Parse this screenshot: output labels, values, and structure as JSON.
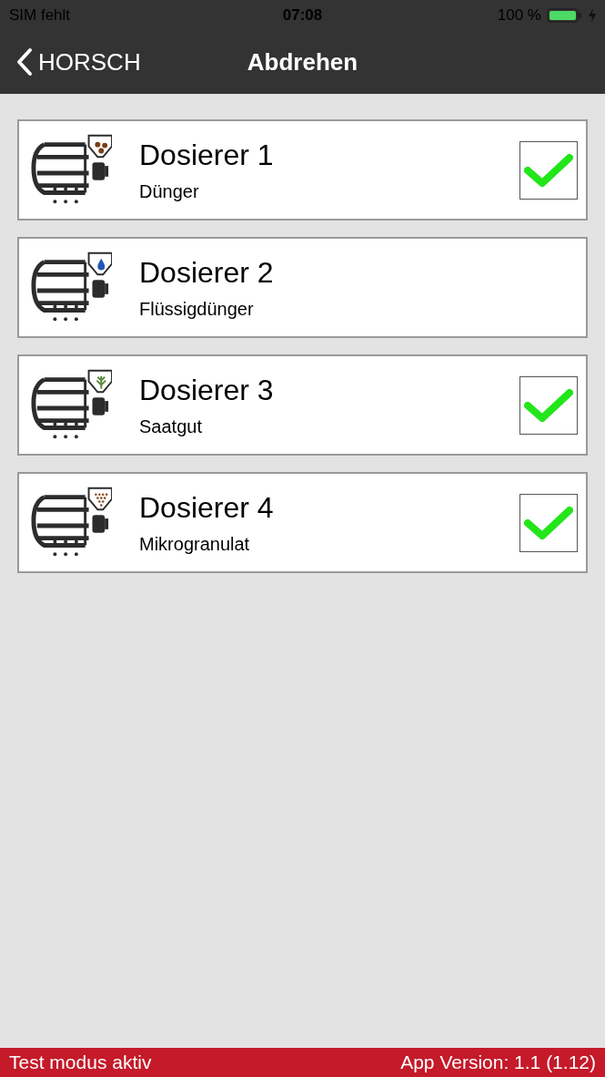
{
  "status_bar": {
    "carrier": "SIM fehlt",
    "time": "07:08",
    "battery": "100 %"
  },
  "nav": {
    "back": "HORSCH",
    "title": "Abdrehen"
  },
  "items": [
    {
      "title": "Dosierer 1",
      "subtitle": "Dünger",
      "kind": "granules",
      "checked": true
    },
    {
      "title": "Dosierer 2",
      "subtitle": "Flüssigdünger",
      "kind": "liquid",
      "checked": false
    },
    {
      "title": "Dosierer 3",
      "subtitle": "Saatgut",
      "kind": "seed",
      "checked": true
    },
    {
      "title": "Dosierer 4",
      "subtitle": "Mikrogranulat",
      "kind": "microgranules",
      "checked": true
    }
  ],
  "footer": {
    "left": "Test modus aktiv",
    "right": "App Version: 1.1 (1.12)"
  }
}
